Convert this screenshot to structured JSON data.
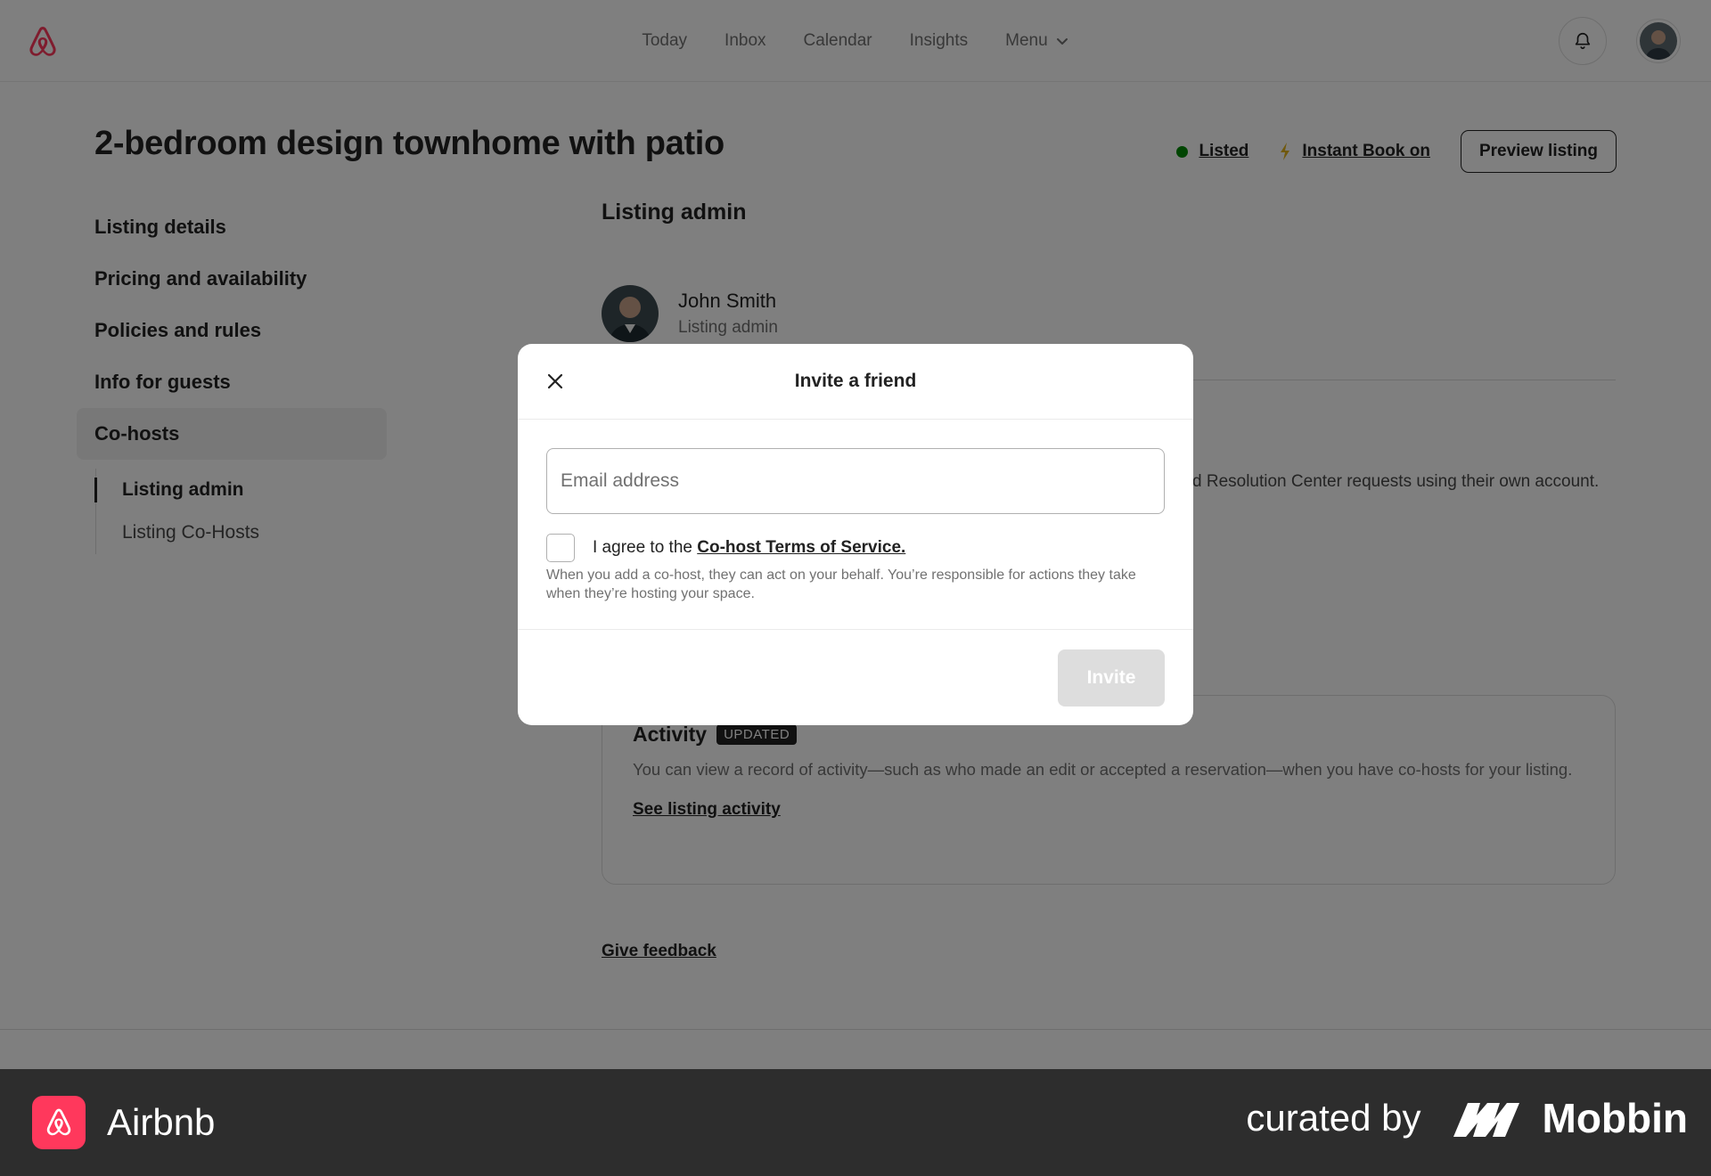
{
  "header": {
    "nav": [
      "Today",
      "Inbox",
      "Calendar",
      "Insights",
      "Menu"
    ],
    "icons": [
      "airbnb-logo",
      "chevron-down-icon",
      "bell-icon",
      "avatar"
    ]
  },
  "listing": {
    "title": "2-bedroom design townhome with patio",
    "status_listed": "Listed",
    "status_instant": "Instant Book on",
    "preview_label": "Preview listing",
    "colors": {
      "listed_dot": "#008a05",
      "instant_bolt": "#e0b21c"
    }
  },
  "sidebar": {
    "items": [
      "Listing details",
      "Pricing and availability",
      "Policies and rules",
      "Info for guests",
      "Co-hosts"
    ],
    "sub_items": [
      "Listing admin",
      "Listing Co-Hosts"
    ]
  },
  "main": {
    "section_title": "Listing admin",
    "admin_name": "John Smith",
    "admin_role": "Listing admin",
    "behind_text": "d Resolution Center requests using their own account.",
    "activity_title": "Activity",
    "activity_badge": "UPDATED",
    "activity_desc": "You can view a record of activity—such as who made an edit or accepted a reservation—when you have co-hosts for your listing.",
    "activity_link": "See listing activity",
    "feedback_link": "Give feedback"
  },
  "modal": {
    "title": "Invite a friend",
    "email_placeholder": "Email address",
    "agree_prefix": "I agree to the ",
    "agree_link": "Co-host Terms of Service.",
    "note": "When you add a co-host, they can act on your behalf. You’re responsible for actions they take when they’re hosting your space.",
    "invite_label": "Invite"
  },
  "brandbar": {
    "app_name": "Airbnb",
    "curated": "curated by",
    "mobbin": "Mobbin",
    "colors": {
      "bar": "#2d2d2d",
      "airbnb": "#ff385c"
    }
  }
}
